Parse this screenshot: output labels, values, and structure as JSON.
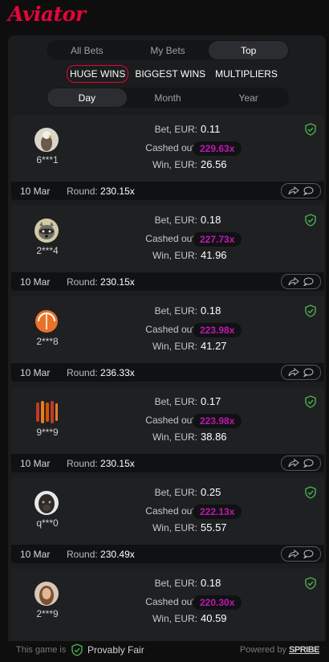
{
  "header": {
    "logo": "Aviator"
  },
  "tabs": [
    {
      "label": "All Bets",
      "active": false
    },
    {
      "label": "My Bets",
      "active": false
    },
    {
      "label": "Top",
      "active": true
    }
  ],
  "categories": [
    {
      "label": "HUGE WINS",
      "active": true
    },
    {
      "label": "BIGGEST WINS",
      "active": false
    },
    {
      "label": "MULTIPLIERS",
      "active": false
    }
  ],
  "periods": [
    {
      "label": "Day",
      "active": true
    },
    {
      "label": "Month",
      "active": false
    },
    {
      "label": "Year",
      "active": false
    }
  ],
  "labels": {
    "bet": "Bet, EUR:",
    "cashed": "Cashed out:",
    "win": "Win, EUR:",
    "round": "Round:"
  },
  "bets": [
    {
      "user": "6***1",
      "bet": "0.11",
      "cashed": "229.63x",
      "win": "26.56",
      "date": "10 Mar",
      "round": "230.15x"
    },
    {
      "user": "2***4",
      "bet": "0.18",
      "cashed": "227.73x",
      "win": "41.96",
      "date": "10 Mar",
      "round": "230.15x"
    },
    {
      "user": "2***8",
      "bet": "0.18",
      "cashed": "223.98x",
      "win": "41.27",
      "date": "10 Mar",
      "round": "236.33x"
    },
    {
      "user": "9***9",
      "bet": "0.17",
      "cashed": "223.98x",
      "win": "38.86",
      "date": "10 Mar",
      "round": "230.15x"
    },
    {
      "user": "q***0",
      "bet": "0.25",
      "cashed": "222.13x",
      "win": "55.57",
      "date": "10 Mar",
      "round": "230.49x"
    },
    {
      "user": "2***9",
      "bet": "0.18",
      "cashed": "220.30x",
      "win": "40.59",
      "date": "",
      "round": ""
    }
  ],
  "footer": {
    "game_is": "This game is",
    "provably_fair": "Provably Fair",
    "powered_by": "Powered by",
    "brand": "SPRIBE"
  },
  "colors": {
    "accent": "#e50539",
    "multiplier": "#c017b4",
    "shield": "#4caf50"
  }
}
